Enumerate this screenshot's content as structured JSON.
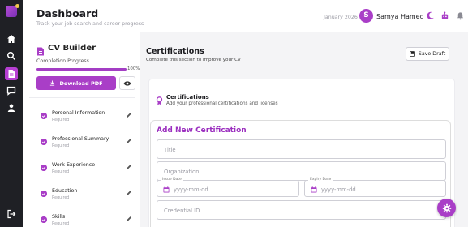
{
  "header": {
    "title": "Dashboard",
    "subtitle": "Track your job search and career progress",
    "date": "January 2026",
    "user_initial": "S",
    "user_name": "Samya Hamed"
  },
  "rail": {
    "icons": [
      "logo-icon",
      "home-icon",
      "search-icon",
      "document-icon",
      "chat-icon",
      "person-icon",
      "logout-icon"
    ]
  },
  "sidebar": {
    "title": "CV Builder",
    "progress_label": "Completion Progress",
    "progress_value": 1.0,
    "progress_text": "100%",
    "download_label": "Download PDF",
    "sections": [
      {
        "name": "Personal Information",
        "status": "Required"
      },
      {
        "name": "Professional Summary",
        "status": "Required"
      },
      {
        "name": "Work Experience",
        "status": "Required"
      },
      {
        "name": "Education",
        "status": "Required"
      },
      {
        "name": "Skills",
        "status": "Required"
      }
    ]
  },
  "main": {
    "title": "Certifications",
    "subtitle": "Complete this section to improve your CV",
    "save_label": "Save Draft",
    "card_title": "Certifications",
    "card_subtitle": "Add your professional certifications and licenses",
    "form_title": "Add New Certification",
    "fields": {
      "title_placeholder": "Title",
      "organization_placeholder": "Organization",
      "issue_label": "Issue Date",
      "issue_placeholder": "yyyy-mm-dd",
      "expiry_label": "Expiry Date",
      "expiry_placeholder": "yyyy-mm-dd",
      "credential_placeholder": "Credential ID"
    }
  },
  "colors": {
    "accent": "#a93ec7",
    "rail": "#1f2025",
    "form_title": "#9b2fbf"
  }
}
